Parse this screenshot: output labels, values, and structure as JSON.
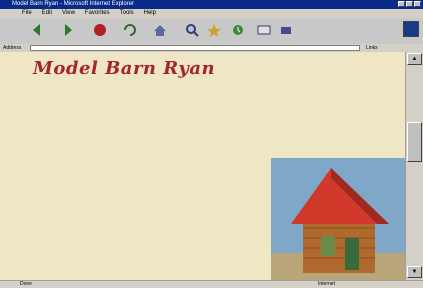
{
  "window": {
    "title": "Model Barn Ryan - Microsoft Internet Explorer"
  },
  "menu": {
    "items": [
      "File",
      "Edit",
      "View",
      "Favorites",
      "Tools",
      "Help"
    ]
  },
  "toolbar": {
    "buttons": [
      "back-icon",
      "forward-icon",
      "stop-icon",
      "refresh-icon",
      "home-icon",
      "search-icon",
      "favorites-icon",
      "history-icon",
      "mail-icon",
      "print-icon"
    ]
  },
  "address": {
    "label": "Address",
    "url": "",
    "links_label": "Links"
  },
  "page": {
    "site_title": "Model Barn Ryan",
    "header_right": [
      "",
      ""
    ],
    "tagline": "",
    "sidebar": {
      "nav": [
        "",
        "",
        "",
        "",
        "",
        ""
      ],
      "head1": "",
      "nav2": [
        "",
        "",
        ""
      ],
      "head2": ""
    },
    "main": {
      "heading": "",
      "line1": "",
      "para1": "",
      "para2": "",
      "para3": "",
      "para4": "",
      "para5": ""
    }
  },
  "status": {
    "text": "Done",
    "zone": "Internet"
  },
  "colors": {
    "title_red": "#a2262c",
    "link_blue": "#1c2a9a",
    "bg_parchment": "#efe6c4"
  }
}
